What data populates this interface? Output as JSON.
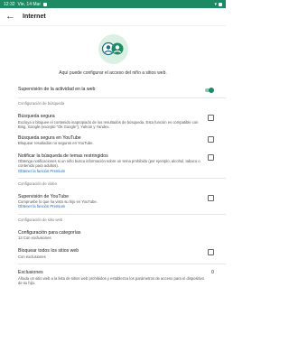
{
  "status": {
    "time": "12:32",
    "date": "Vie, 14 Mar"
  },
  "header": {
    "back_icon": "arrow-back-icon",
    "title": "Internet"
  },
  "hero": {
    "icon": "children-icon",
    "text": "Aquí puede configurar el acceso del niño a sitios web."
  },
  "supervision": {
    "label": "Supervisión de la actividad en la web",
    "enabled": true
  },
  "sections": {
    "search": "Configuración de búsqueda",
    "video": "Configuración de vídeo",
    "web": "Configuración de sitio web"
  },
  "safe_search": {
    "label": "Búsqueda segura",
    "desc": "Excluya o bloquee el contenido inapropiado de los resultados de búsqueda. Esta función es compatible con Bing, Google (excepto \"Ok Google\"), Yahoo! y Yandex.",
    "checked": false
  },
  "youtube_safe": {
    "label": "Búsqueda segura en YouTube",
    "desc": "Bloquear resultados no seguros en YouTube.",
    "checked": false
  },
  "restricted_notify": {
    "label": "Notificar la búsqueda de temas restringidos",
    "desc": "Obtenga notificaciones si un niño busca información sobre un tema prohibido (por ejemplo, alcohol, tabaco o contenido para adultos).",
    "link": "Obtener la función Premium",
    "checked": false
  },
  "youtube_supervision": {
    "label": "Supervisión de YouTube",
    "desc": "Compruebe lo que ha visto su hijo en YouTube.",
    "link": "Obtener la función Premium",
    "checked": false
  },
  "categories": {
    "label": "Configuración para categorías",
    "desc": "13 Con exclusiones"
  },
  "block_all": {
    "label": "Bloquear todos los sitios web",
    "desc": "Con exclusiones",
    "checked": false
  },
  "exclusions": {
    "label": "Exclusiones",
    "count": "0",
    "desc": "Añada un sitio web a la lista de sitios web prohibidos y establezca los parámetros de acceso para el dispositivo de su hijo."
  },
  "colors": {
    "accent": "#1e8a63",
    "link": "#1565c0"
  }
}
